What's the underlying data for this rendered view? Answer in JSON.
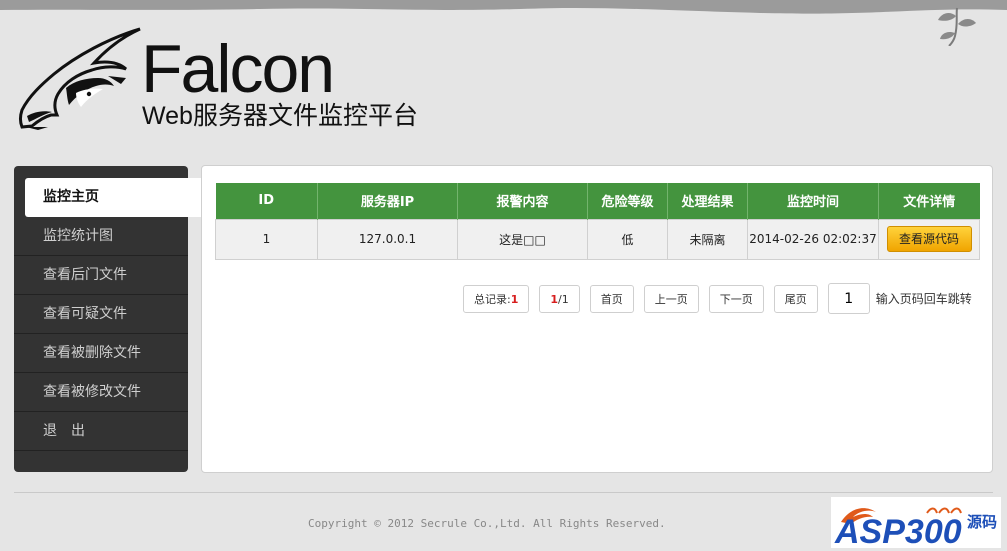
{
  "brand": {
    "title": "Falcon",
    "subtitle": "Web服务器文件监控平台"
  },
  "sidebar": {
    "items": [
      {
        "label": "监控主页",
        "active": true
      },
      {
        "label": "监控统计图"
      },
      {
        "label": "查看后门文件"
      },
      {
        "label": "查看可疑文件"
      },
      {
        "label": "查看被删除文件"
      },
      {
        "label": "查看被修改文件"
      },
      {
        "label": "退　出"
      }
    ]
  },
  "table": {
    "headers": [
      "ID",
      "服务器IP",
      "报警内容",
      "危险等级",
      "处理结果",
      "监控时间",
      "文件详情"
    ],
    "rows": [
      {
        "id": "1",
        "ip": "127.0.0.1",
        "content": "这是□□",
        "level": "低",
        "result": "未隔离",
        "time": "2014-02-26 02:02:37",
        "action": "查看源代码"
      }
    ]
  },
  "pager": {
    "total_label": "总记录:",
    "total": "1",
    "current": "1",
    "total_pages": "/1",
    "first": "首页",
    "prev": "上一页",
    "next": "下一页",
    "last": "尾页",
    "page_value": "1",
    "jump_hint": "输入页码回车跳转"
  },
  "footer": {
    "copyright": "Copyright © 2012 Secrule Co.,Ltd. All Rights Reserved."
  },
  "watermark": {
    "main": "ASP300",
    "side": "源码",
    "colors": {
      "text": "#1d4fb8",
      "accent": "#e05a1a"
    }
  },
  "colors": {
    "header_green": "#44943e",
    "sidebar_bg": "#333333",
    "button_orange": "#f0a400",
    "count_red": "#d71e1e"
  }
}
